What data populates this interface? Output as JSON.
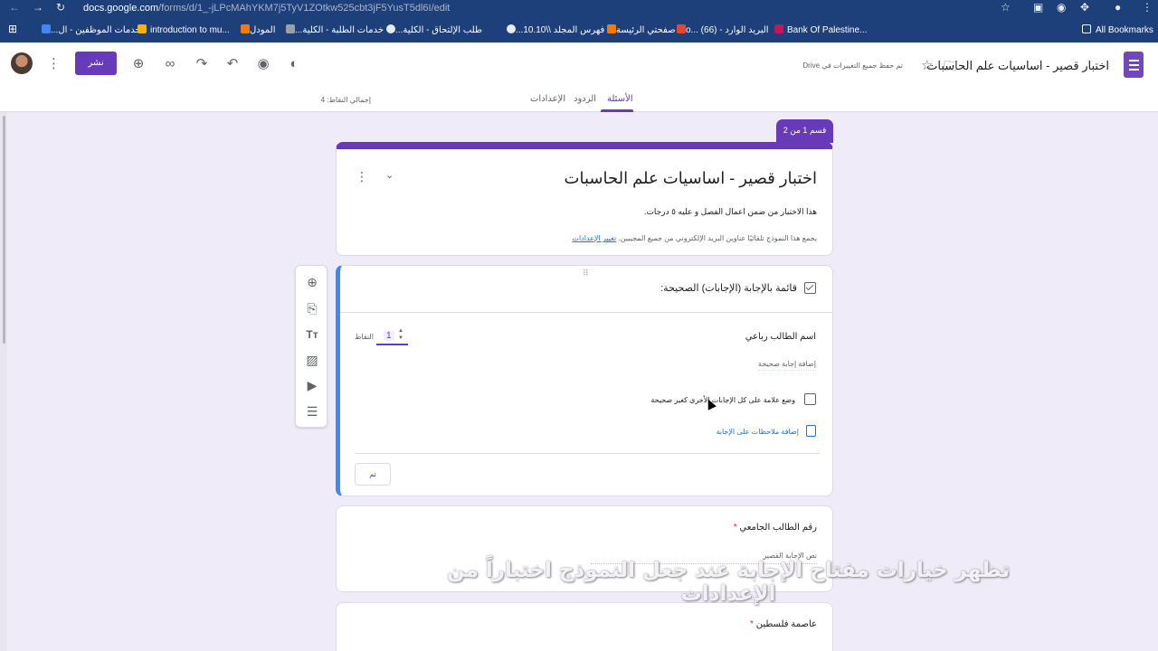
{
  "browser": {
    "url_host": "docs.google.com",
    "url_path": "/forms/d/1_-jLPcMAhYKM7j5TyV1ZOtkw525cbt3jF5YusT5dl6I/edit",
    "bookmarks": [
      "خدمات الموظفين - ال...",
      "introduction to mu...",
      "المودل",
      "خدمات الطلبة - الكلية...",
      "طلب الإلتحاق - الكلية...",
      "فهرس المجلد \\\\10.10...",
      "صفحتي الرئيسة",
      "البريد الوارد - o... (66)",
      "Bank Of Palestine..."
    ],
    "all_bookmarks": "All Bookmarks"
  },
  "header": {
    "form_title": "اختبار قصير - اساسيات علم الحاسبات",
    "saved_status": "تم حفظ جميع التغييرات في Drive",
    "publish_label": "نشر"
  },
  "tabs": {
    "questions": "الأسئلة",
    "responses": "الردود",
    "settings": "الإعدادات",
    "total_points": "إجمالي النقاط: 4"
  },
  "section_tag": "قسم 1 من 2",
  "form": {
    "title": "اختبار قصير - اساسيات علم الحاسبات",
    "description": "هذا الاختبار من ضمن اعمال الفصل و عليه ٥ درجات.",
    "collect_text": "يجمع هذا النموذج تلقائيًا عناوين البريد الإلكتروني من جميع المجيبين.",
    "change_settings": "تغيير الإعدادات"
  },
  "answer_key": {
    "heading": "قائمة بالإجابة (الإجابات) الصحيحة:",
    "question": "اسم الطالب رباعي",
    "points_value": "1",
    "points_label": "النقاط",
    "add_correct_answer": "إضافة إجابة صحيحة",
    "mark_others_wrong": "وضع علامة على كل الإجابات الأخرى كغير صحيحة",
    "add_feedback": "إضافة ملاحظات على الإجابة",
    "done": "تم"
  },
  "questions": [
    {
      "title": "رقم الطالب الجامعي",
      "required": "*",
      "placeholder": "نص الإجابة القصير"
    },
    {
      "title": "عاصمة فلسطين",
      "required": "*"
    }
  ],
  "caption": "تظهر خيارات مفتاح الإجابة عند جعل النموذج اختباراً من الإعدادات",
  "colors": {
    "accent": "#673ab7",
    "background": "#f0ebf8",
    "chrome": "#1d3f7a",
    "link": "#1a73e8"
  }
}
